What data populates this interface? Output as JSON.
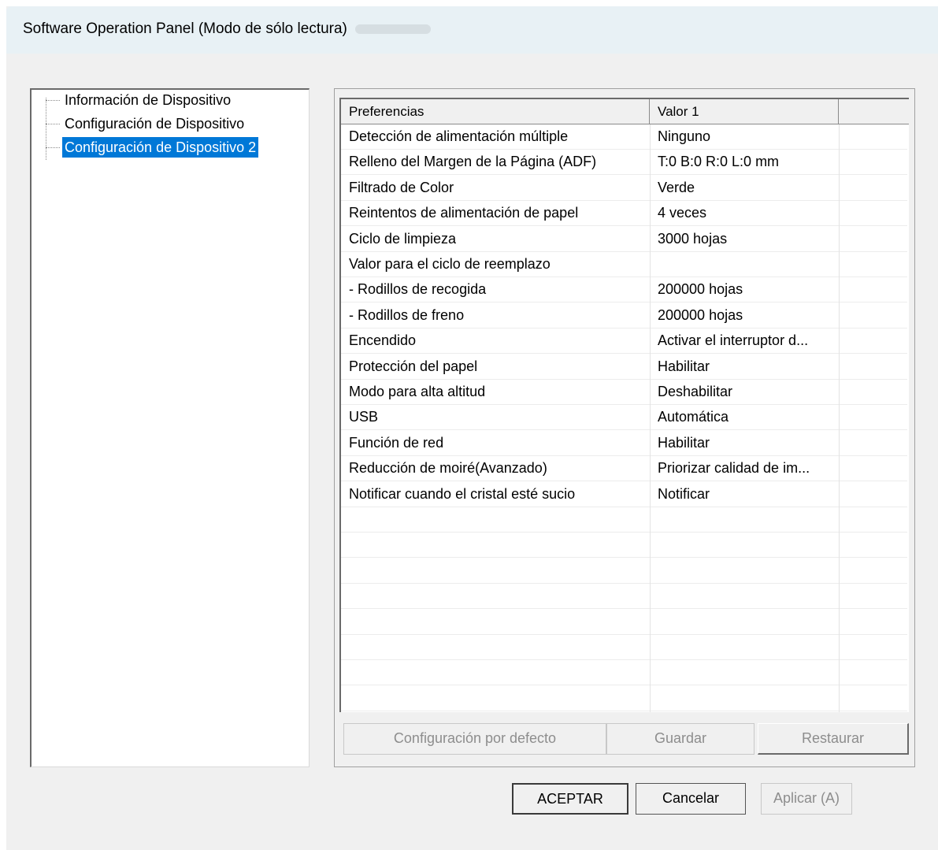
{
  "window": {
    "title": "Software Operation Panel (Modo de sólo lectura)"
  },
  "tree": {
    "items": [
      {
        "label": "Información de Dispositivo",
        "selected": false
      },
      {
        "label": "Configuración de Dispositivo",
        "selected": false
      },
      {
        "label": "Configuración de Dispositivo 2",
        "selected": true
      }
    ]
  },
  "grid": {
    "columns": [
      "Preferencias",
      "Valor 1",
      ""
    ],
    "rows": [
      {
        "pref": "Detección de alimentación múltiple",
        "value": "Ninguno"
      },
      {
        "pref": "Relleno del Margen de la Página (ADF)",
        "value": "T:0  B:0  R:0  L:0 mm"
      },
      {
        "pref": "Filtrado de Color",
        "value": "Verde"
      },
      {
        "pref": "Reintentos de alimentación de papel",
        "value": "4 veces"
      },
      {
        "pref": "Ciclo de limpieza",
        "value": "3000 hojas"
      },
      {
        "pref": "Valor para el ciclo de reemplazo",
        "value": ""
      },
      {
        "pref": " - Rodillos de recogida",
        "value": "200000 hojas"
      },
      {
        "pref": " - Rodillos de freno",
        "value": "200000 hojas"
      },
      {
        "pref": "Encendido",
        "value": "Activar el interruptor d..."
      },
      {
        "pref": "Protección del papel",
        "value": "Habilitar"
      },
      {
        "pref": "Modo para alta altitud",
        "value": "Deshabilitar"
      },
      {
        "pref": "USB",
        "value": "Automática"
      },
      {
        "pref": "Función de red",
        "value": "Habilitar"
      },
      {
        "pref": "Reducción de moiré(Avanzado)",
        "value": "Priorizar calidad de im..."
      },
      {
        "pref": "Notificar cuando el cristal esté sucio",
        "value": "Notificar"
      }
    ],
    "empty_rows": 8
  },
  "panel_buttons": {
    "defaults": "Configuración por defecto",
    "save": "Guardar",
    "restore": "Restaurar"
  },
  "dialog_buttons": {
    "ok": "ACEPTAR",
    "cancel": "Cancelar",
    "apply": "Aplicar (A)"
  }
}
